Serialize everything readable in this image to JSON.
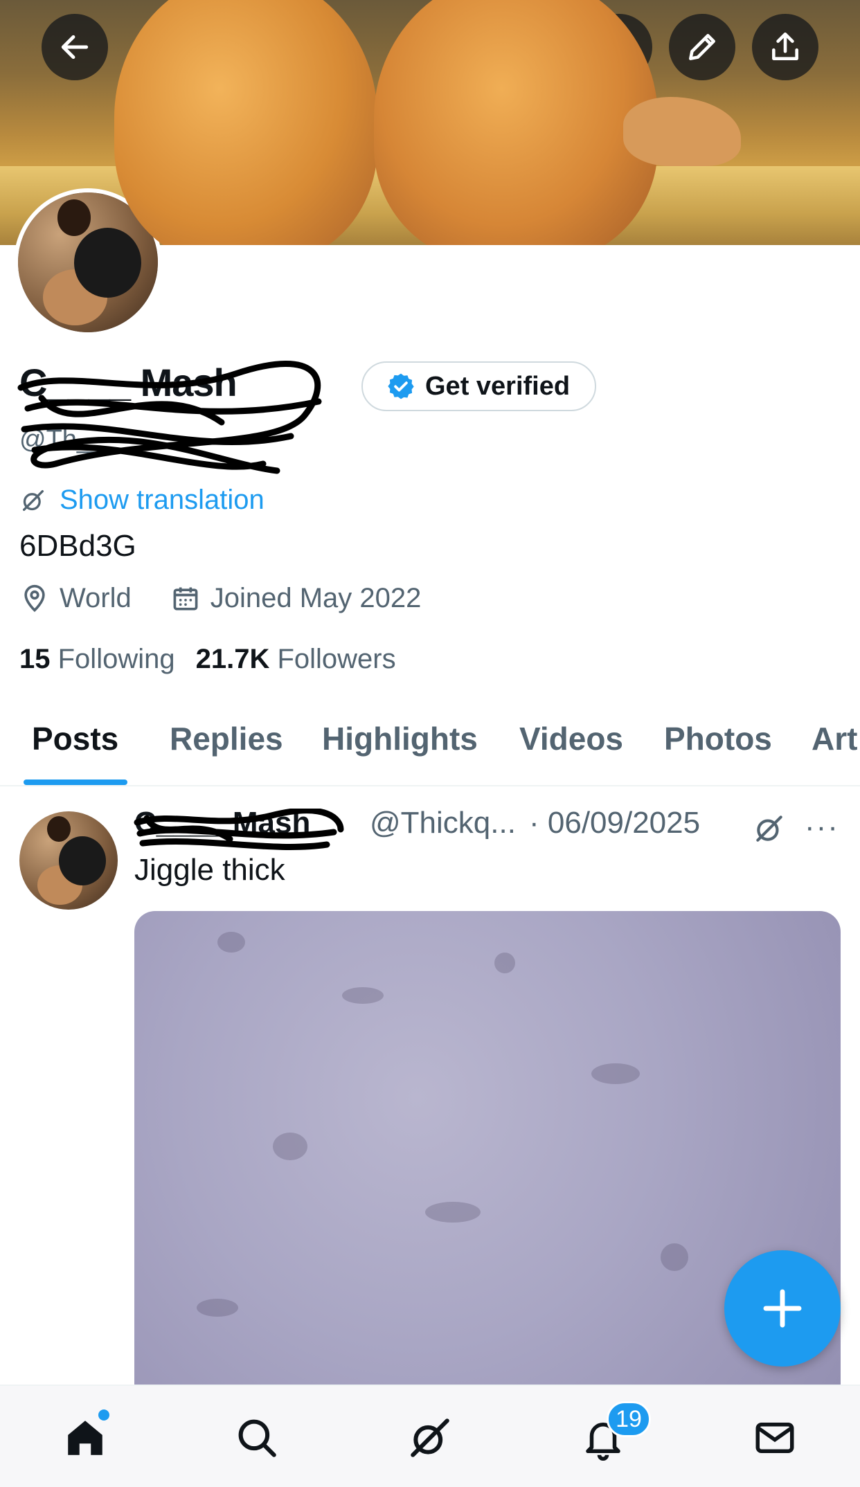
{
  "profile": {
    "name": "C____ Mash",
    "handle": "@Th____",
    "verify_label": "Get verified",
    "translate_label": "Show translation",
    "bio": "6DBd3G",
    "location": "World",
    "joined": "Joined May 2022",
    "following_count": "15",
    "following_label": "Following",
    "followers_count": "21.7K",
    "followers_label": "Followers"
  },
  "tabs": [
    {
      "label": "Posts",
      "active": true
    },
    {
      "label": "Replies"
    },
    {
      "label": "Highlights"
    },
    {
      "label": "Videos"
    },
    {
      "label": "Photos"
    },
    {
      "label": "Art"
    }
  ],
  "post": {
    "name": "C____ Mash",
    "handle": "@Thickq...",
    "date": "· 06/09/2025",
    "text": "Jiggle thick",
    "more": "···"
  },
  "nav": {
    "notifications_badge": "19"
  },
  "colors": {
    "accent": "#1d9bf0",
    "text": "#0f1419",
    "secondary": "#536471"
  }
}
